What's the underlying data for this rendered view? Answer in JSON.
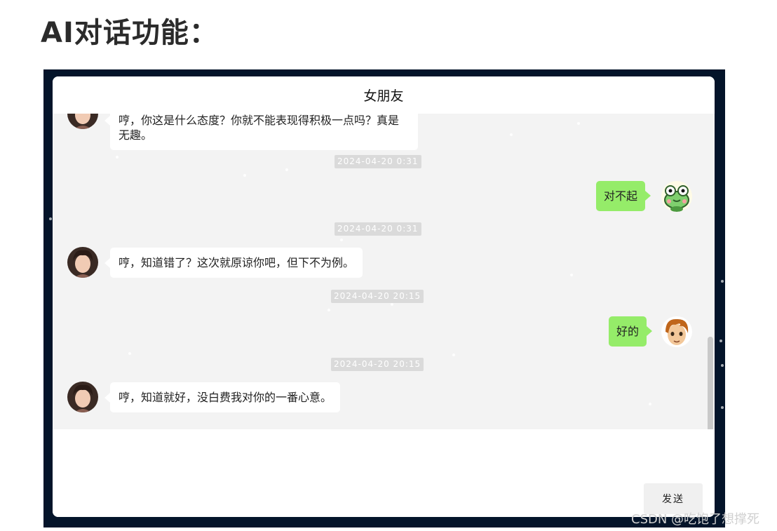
{
  "page": {
    "heading": "AI对话功能："
  },
  "chat": {
    "title": "女朋友",
    "messages": [
      {
        "side": "left",
        "text": "哼，你这是什么态度？你就不能表现得积极一点吗？真是无趣。"
      },
      {
        "type": "timestamp",
        "text": "2024-04-20 0:31"
      },
      {
        "side": "right",
        "text": "对不起",
        "avatar": "frog-avatar"
      },
      {
        "type": "timestamp",
        "text": "2024-04-20 0:31"
      },
      {
        "side": "left",
        "text": "哼，知道错了？这次就原谅你吧，但下不为例。"
      },
      {
        "type": "timestamp",
        "text": "2024-04-20 20:15"
      },
      {
        "side": "right",
        "text": "好的",
        "avatar": "cartoon-boy-avatar"
      },
      {
        "type": "timestamp",
        "text": "2024-04-20 20:15"
      },
      {
        "side": "left",
        "text": "哼，知道就好，没白费我对你的一番心意。"
      }
    ],
    "input": {
      "value": "",
      "placeholder": ""
    },
    "send_label": "发送"
  },
  "watermark": "CSDN @吃饱了想撑死",
  "colors": {
    "frame_bg": "#04142a",
    "chat_bg": "#f3f3f3",
    "self_bubble": "#95ec69",
    "other_bubble": "#ffffff",
    "timestamp_bg": "#dadada"
  }
}
